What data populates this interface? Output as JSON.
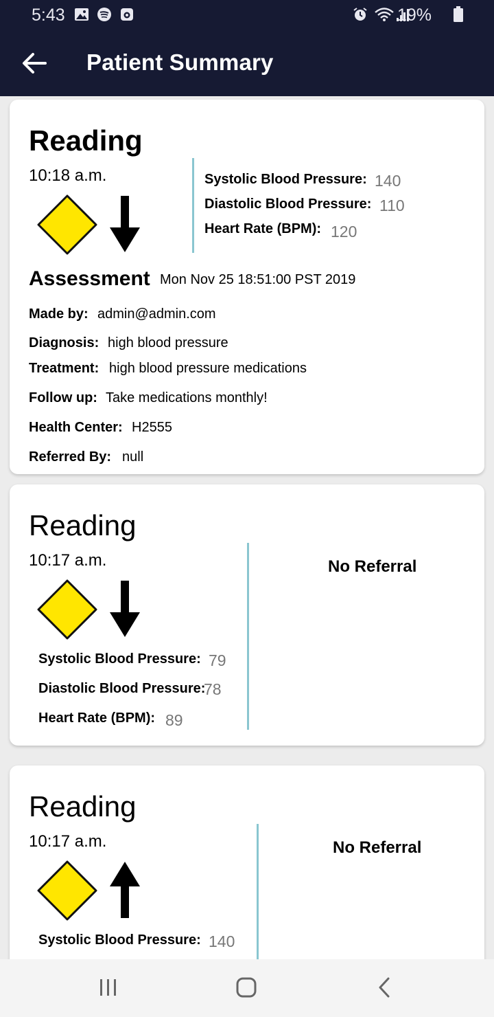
{
  "status_bar": {
    "time": "5:43",
    "battery_percent": "19%",
    "left_icons": [
      "gallery-icon",
      "spotify-icon",
      "camera-app-icon"
    ],
    "right_icons": [
      "alarm-icon",
      "wifi-icon",
      "signal-icon",
      "battery-icon"
    ]
  },
  "app_bar": {
    "title": "Patient Summary",
    "back_icon": "arrow-left-icon",
    "background": "#161a33"
  },
  "colors": {
    "warning_yellow": "#ffe600",
    "divider_teal": "#8ac6d0",
    "value_gray": "#777777"
  },
  "readings": [
    {
      "title": "Reading",
      "time": "10:18 a.m.",
      "status_icon": "yellow-diamond-icon",
      "trend_icon": "arrow-down-icon",
      "vitals": [
        {
          "label": "Systolic Blood Pressure:",
          "value": "140"
        },
        {
          "label": "Diastolic Blood Pressure:",
          "value": "110"
        },
        {
          "label": "Heart Rate (BPM):",
          "value": "120"
        }
      ],
      "assessment": {
        "title": "Assessment",
        "date": "Mon Nov 25 18:51:00 PST 2019",
        "fields": [
          {
            "label": "Made by:",
            "value": "admin@admin.com"
          },
          {
            "label": "Diagnosis:",
            "value": "high blood pressure"
          },
          {
            "label": "Treatment:",
            "value": "high blood pressure medications"
          },
          {
            "label": "Follow up:",
            "value": "Take medications monthly!"
          },
          {
            "label": "Health Center:",
            "value": "H2555"
          },
          {
            "label": "Referred By:",
            "value": "null"
          }
        ]
      }
    },
    {
      "title": "Reading",
      "time": "10:17 a.m.",
      "status_icon": "yellow-diamond-icon",
      "trend_icon": "arrow-down-icon",
      "referral": "No Referral",
      "vitals": [
        {
          "label": "Systolic Blood Pressure:",
          "value": "79"
        },
        {
          "label": "Diastolic Blood Pressure:",
          "value": "78"
        },
        {
          "label": "Heart Rate (BPM):",
          "value": "89"
        }
      ]
    },
    {
      "title": "Reading",
      "time": "10:17 a.m.",
      "status_icon": "yellow-diamond-icon",
      "trend_icon": "arrow-up-icon",
      "referral": "No Referral",
      "vitals": [
        {
          "label": "Systolic Blood Pressure:",
          "value": "140"
        }
      ]
    }
  ],
  "nav_bar": {
    "icons": [
      "recent-apps-icon",
      "home-icon",
      "back-icon"
    ]
  }
}
